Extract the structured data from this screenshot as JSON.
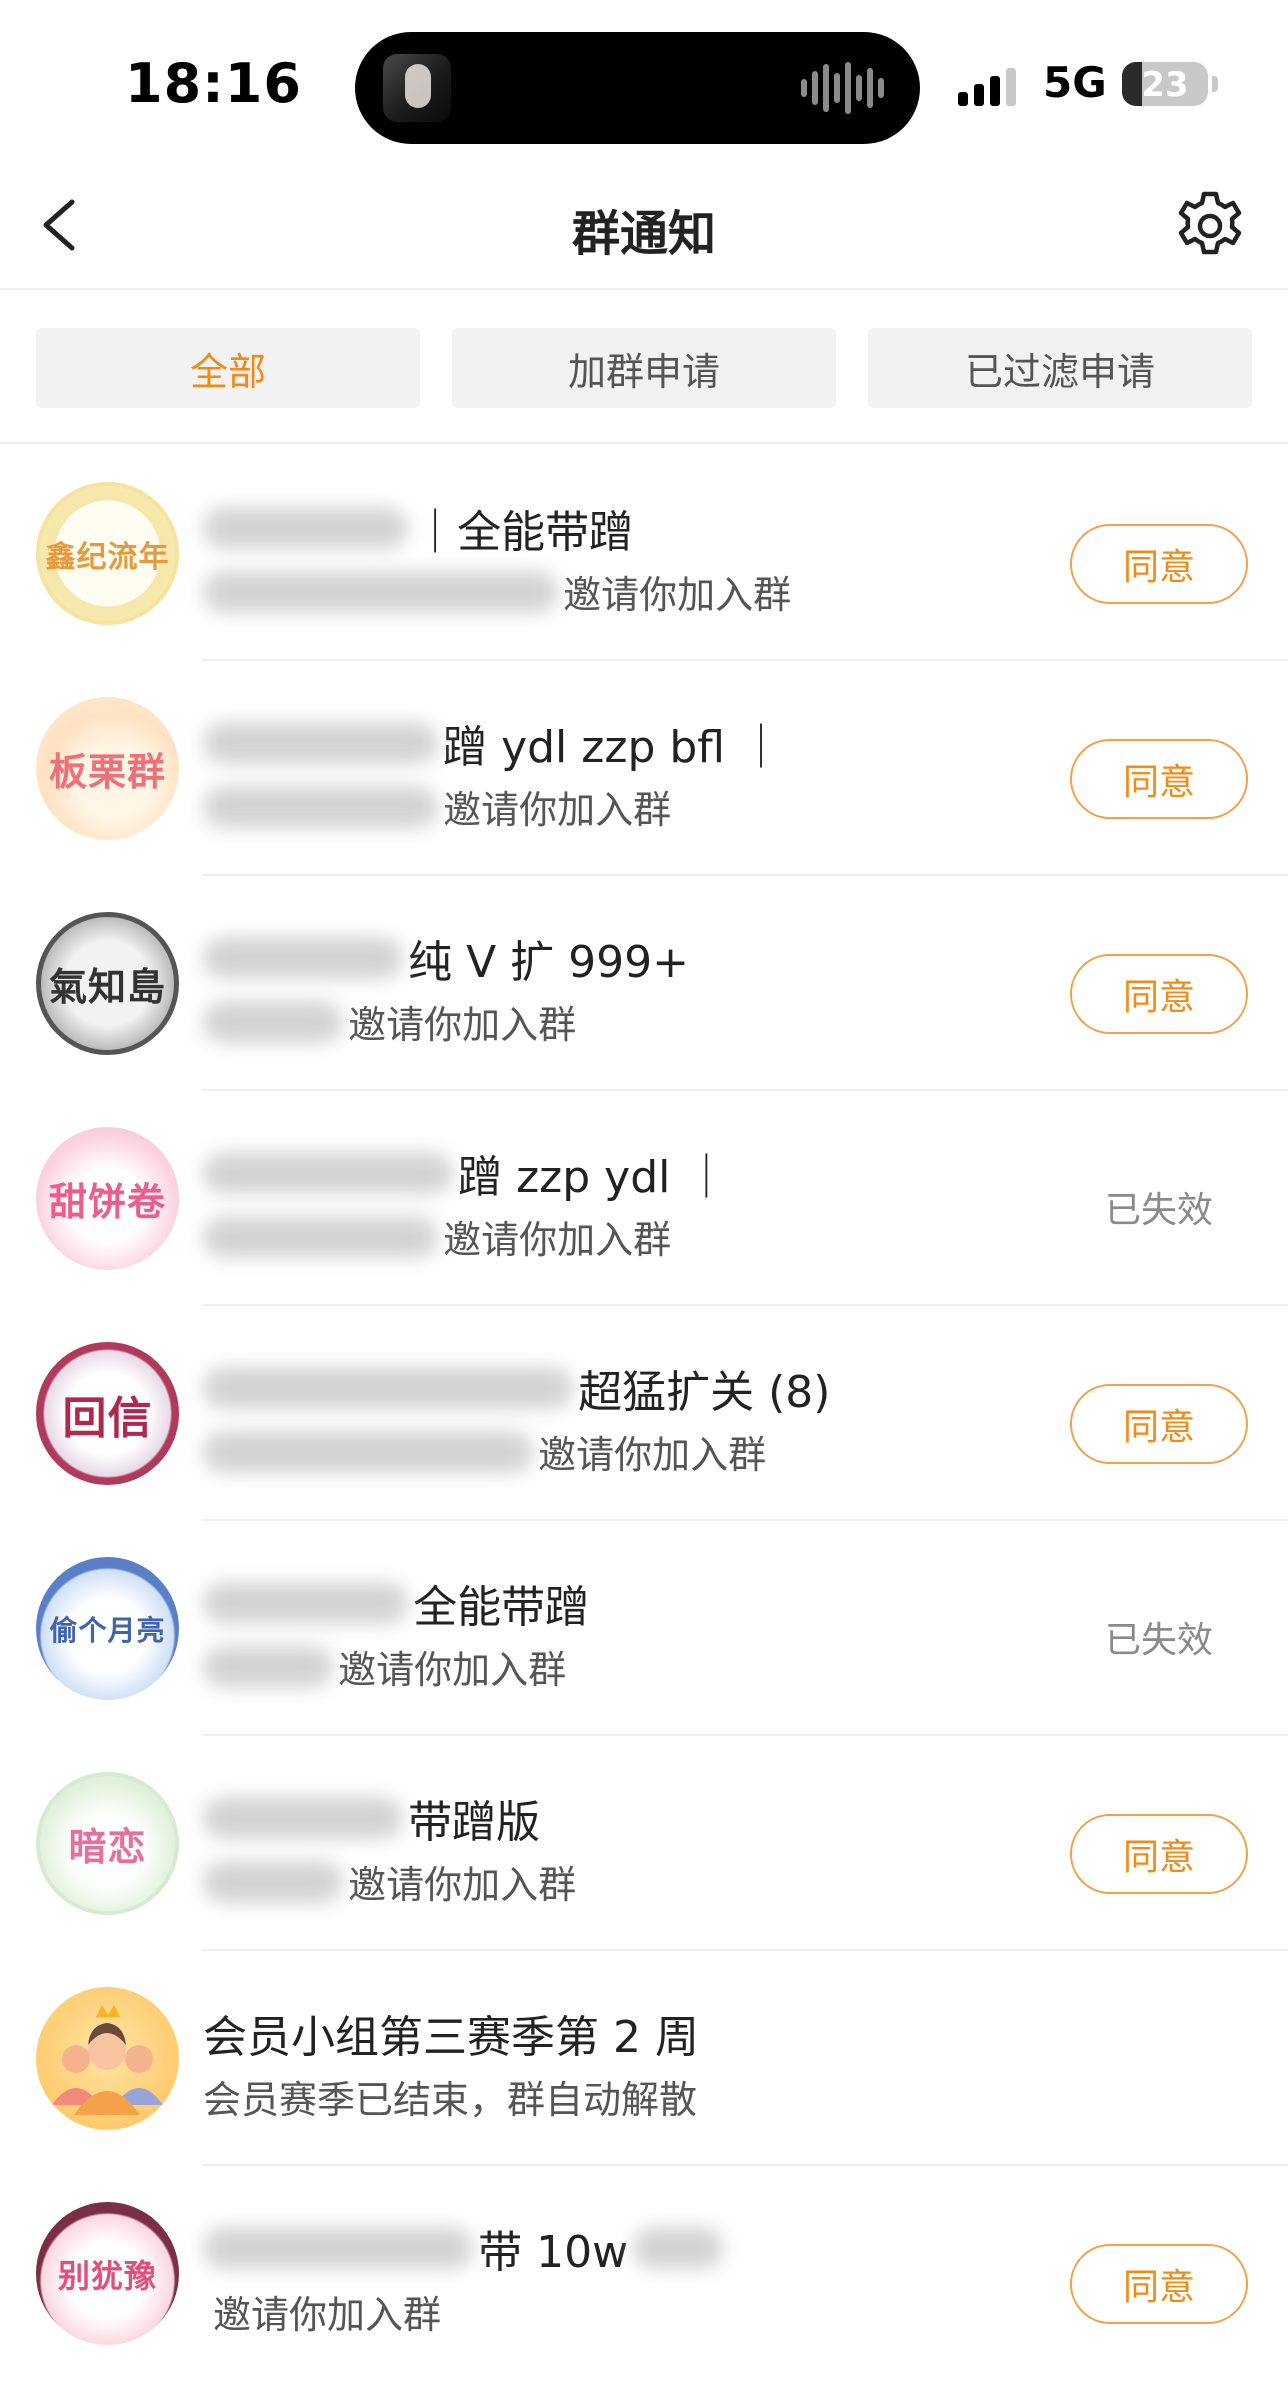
{
  "status_bar": {
    "time": "18:16",
    "network": "5G",
    "battery": "23",
    "battery_level": 0.23
  },
  "header": {
    "title": "群通知"
  },
  "tabs": [
    {
      "label": "全部",
      "active": true
    },
    {
      "label": "加群申请",
      "active": false
    },
    {
      "label": "已过滤申请",
      "active": false
    }
  ],
  "colors": {
    "accent": "#f28a16",
    "button_border": "#f0a14a",
    "tab_bg": "#f2f2f2",
    "divider": "#efefef"
  },
  "notifications": [
    {
      "avatar_text": "鑫纪流年",
      "title": "｜全能带蹭",
      "subtitle": "邀请你加入群",
      "action": "同意",
      "status": "pending"
    },
    {
      "avatar_text": "板栗群",
      "title": "蹭 ydl  zzp  bfl ｜",
      "subtitle": "邀请你加入群",
      "action": "同意",
      "status": "pending"
    },
    {
      "avatar_text": "氣知島",
      "title": "纯 V 扩 999+",
      "subtitle": "邀请你加入群",
      "action": "同意",
      "status": "pending"
    },
    {
      "avatar_text": "甜饼卷",
      "title": "蹭 zzp ydl ｜",
      "subtitle": "邀请你加入群",
      "action": "已失效",
      "status": "expired"
    },
    {
      "avatar_text": "回信",
      "title": "超猛扩关 (8)",
      "subtitle": "邀请你加入群",
      "action": "同意",
      "status": "pending"
    },
    {
      "avatar_text": "偷个月亮",
      "title": "全能带蹭",
      "subtitle": "邀请你加入群",
      "action": "已失效",
      "status": "expired"
    },
    {
      "avatar_text": "暗恋",
      "title": "带蹭版",
      "subtitle": "邀请你加入群",
      "action": "同意",
      "status": "pending"
    },
    {
      "avatar_text": "",
      "title": "会员小组第三赛季第 2 周",
      "subtitle": "会员赛季已结束，群自动解散",
      "action": "",
      "status": "none"
    },
    {
      "avatar_text": "别犹豫",
      "title": "带 10w",
      "subtitle": "邀请你加入群",
      "action": "同意",
      "status": "pending"
    }
  ]
}
